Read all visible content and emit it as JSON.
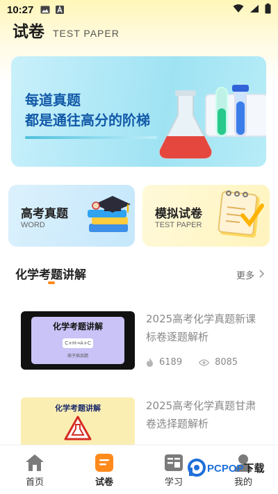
{
  "status_bar": {
    "time": "10:27"
  },
  "header": {
    "title": "试卷",
    "subtitle": "TEST PAPER"
  },
  "banner": {
    "line1": "每道真题",
    "line2": "都是通往高分的阶梯"
  },
  "cards": [
    {
      "title": "高考真题",
      "subtitle": "WORD"
    },
    {
      "title": "模拟试卷",
      "subtitle": "TEST PAPER"
    }
  ],
  "section": {
    "title": "化学考题讲解",
    "more": "更多"
  },
  "articles": [
    {
      "thumb_title": "化学考题讲解",
      "thumb_formula": "C+H→A+C",
      "thumb_caption": "周子辰品题",
      "title": "2025高考化学真题新课标卷逐题解析",
      "likes": "6189",
      "views": "8085"
    },
    {
      "thumb_title": "化学考题讲解",
      "title": "2025高考化学真题甘肃卷选择题解析"
    }
  ],
  "bottom_nav": [
    {
      "label": "首页",
      "icon": "home-icon"
    },
    {
      "label": "试卷",
      "icon": "paper-icon"
    },
    {
      "label": "学习",
      "icon": "study-icon"
    },
    {
      "label": "我的",
      "icon": "profile-icon"
    }
  ],
  "watermark": {
    "brand": "PCPOP",
    "suffix": "下载"
  },
  "colors": {
    "accent": "#ff8a1c",
    "banner_text": "#1259a8",
    "header_bg": "#fff6b8"
  }
}
